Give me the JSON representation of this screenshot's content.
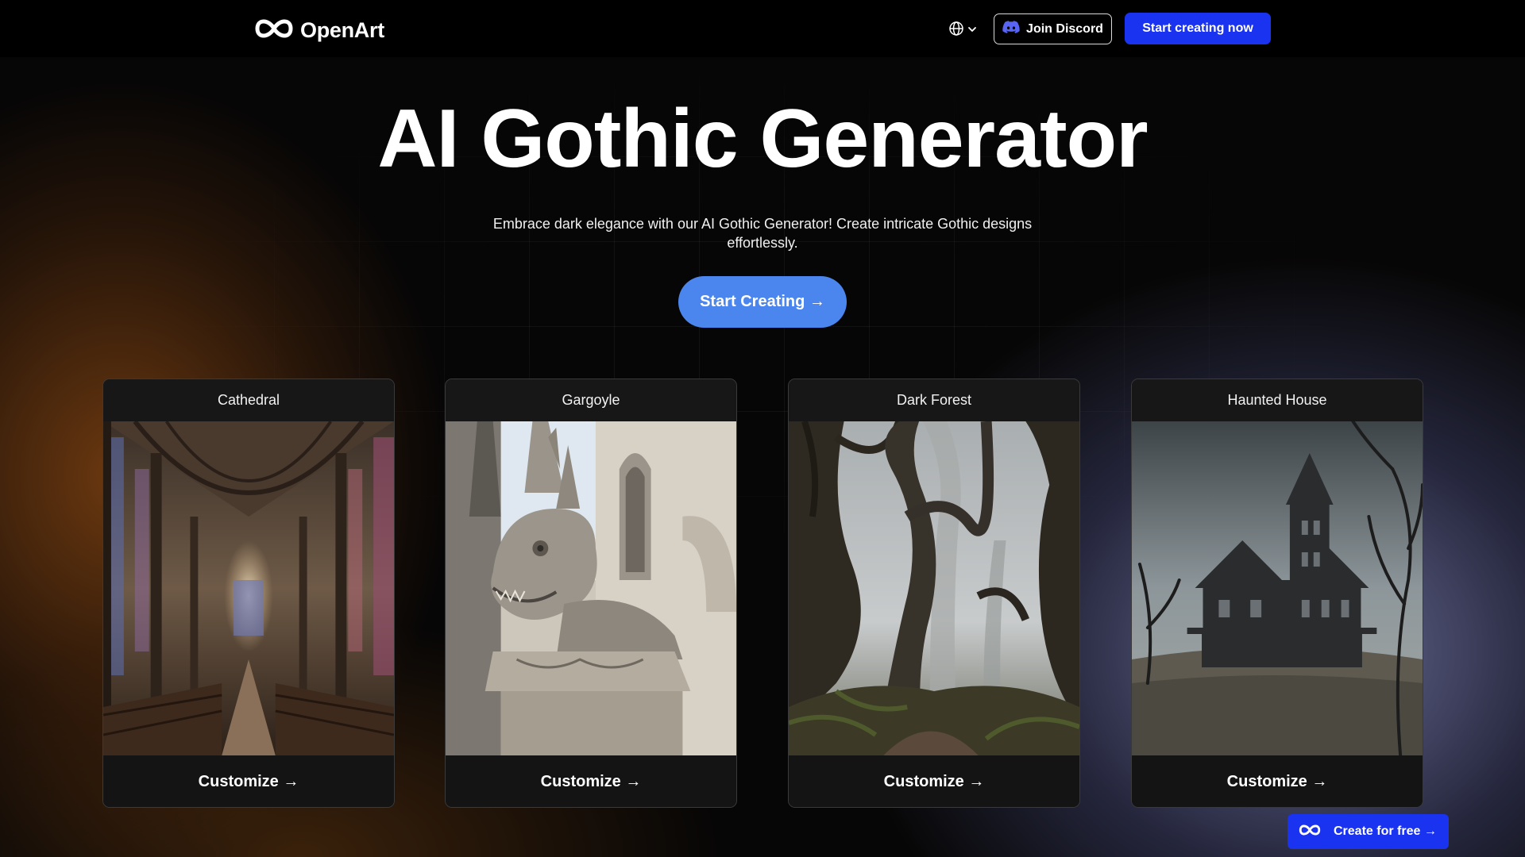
{
  "header": {
    "logo_text": "OpenArt",
    "join_discord_label": "Join Discord",
    "start_creating_label": "Start creating now"
  },
  "hero": {
    "title": "AI Gothic Generator",
    "subtitle": "Embrace dark elegance with our AI Gothic Generator! Create intricate Gothic designs effortlessly.",
    "cta_label": "Start Creating →"
  },
  "cards": [
    {
      "title": "Cathedral",
      "button_label": "Customize →",
      "image": "cathedral-interior"
    },
    {
      "title": "Gargoyle",
      "button_label": "Customize →",
      "image": "stone-gargoyle"
    },
    {
      "title": "Dark Forest",
      "button_label": "Customize →",
      "image": "misty-forest"
    },
    {
      "title": "Haunted House",
      "button_label": "Customize →",
      "image": "victorian-haunted-house"
    }
  ],
  "floating_cta": {
    "label": "Create for free →"
  },
  "icons": {
    "logo": "openart-infinity-icon",
    "language": "globe-icon",
    "dropdown": "chevron-down-icon",
    "discord": "discord-icon"
  },
  "colors": {
    "brand_blue": "#1a33f0",
    "hero_cta": "#4b86ee",
    "background": "#070606"
  }
}
